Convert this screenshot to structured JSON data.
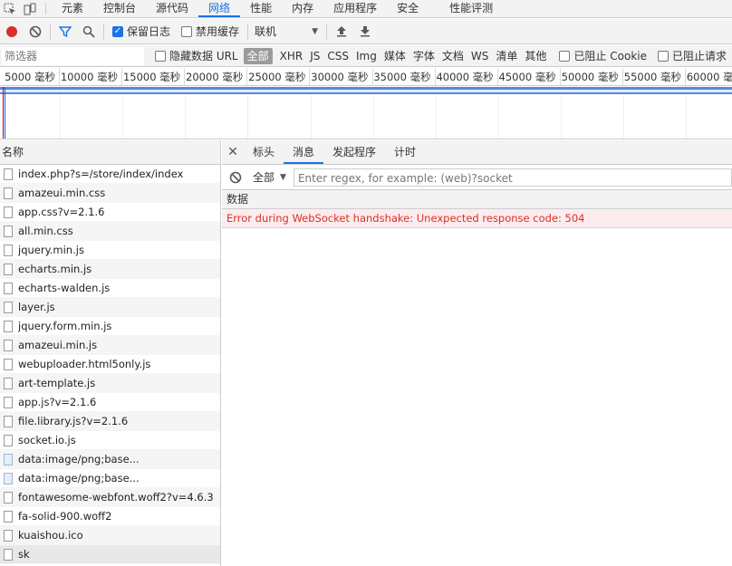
{
  "top_tabs": [
    "元素",
    "控制台",
    "源代码",
    "网络",
    "性能",
    "内存",
    "应用程序",
    "安全",
    "性能评测"
  ],
  "active_tab_index": 3,
  "toolbar": {
    "preserve_log_label": "保留日志",
    "preserve_log_checked": true,
    "disable_cache_label": "禁用缓存",
    "disable_cache_checked": false,
    "throttle_value": "联机"
  },
  "filter": {
    "placeholder": "筛选器",
    "hide_data_urls_label": "隐藏数据 URL",
    "types": [
      "全部",
      "XHR",
      "JS",
      "CSS",
      "Img",
      "媒体",
      "字体",
      "文档",
      "WS",
      "清单",
      "其他"
    ],
    "active_type_index": 0,
    "blocked_cookies_label": "已阻止 Cookie",
    "blocked_requests_label": "已阻止请求"
  },
  "ruler_ticks": [
    "5000 毫秒",
    "10000 毫秒",
    "15000 毫秒",
    "20000 毫秒",
    "25000 毫秒",
    "30000 毫秒",
    "35000 毫秒",
    "40000 毫秒",
    "45000 毫秒",
    "50000 毫秒",
    "55000 毫秒",
    "60000 毫秒"
  ],
  "requests": {
    "header": "名称",
    "items": [
      {
        "name": "index.php?s=/store/index/index",
        "kind": "doc"
      },
      {
        "name": "amazeui.min.css",
        "kind": "doc"
      },
      {
        "name": "app.css?v=2.1.6",
        "kind": "doc"
      },
      {
        "name": "all.min.css",
        "kind": "doc"
      },
      {
        "name": "jquery.min.js",
        "kind": "doc"
      },
      {
        "name": "echarts.min.js",
        "kind": "doc"
      },
      {
        "name": "echarts-walden.js",
        "kind": "doc"
      },
      {
        "name": "layer.js",
        "kind": "doc"
      },
      {
        "name": "jquery.form.min.js",
        "kind": "doc"
      },
      {
        "name": "amazeui.min.js",
        "kind": "doc"
      },
      {
        "name": "webuploader.html5only.js",
        "kind": "doc"
      },
      {
        "name": "art-template.js",
        "kind": "doc"
      },
      {
        "name": "app.js?v=2.1.6",
        "kind": "doc"
      },
      {
        "name": "file.library.js?v=2.1.6",
        "kind": "doc"
      },
      {
        "name": "socket.io.js",
        "kind": "doc"
      },
      {
        "name": "data:image/png;base...",
        "kind": "img"
      },
      {
        "name": "data:image/png;base...",
        "kind": "img"
      },
      {
        "name": "fontawesome-webfont.woff2?v=4.6.3",
        "kind": "doc"
      },
      {
        "name": "fa-solid-900.woff2",
        "kind": "doc"
      },
      {
        "name": "kuaishou.ico",
        "kind": "doc"
      },
      {
        "name": "sk",
        "kind": "doc",
        "selected": true
      }
    ]
  },
  "detail": {
    "tabs": [
      "标头",
      "消息",
      "发起程序",
      "计时"
    ],
    "active_tab_index": 1,
    "message_filter_label": "全部",
    "regex_placeholder": "Enter regex, for example: (web)?socket",
    "data_header": "数据",
    "error_message": "Error during WebSocket handshake: Unexpected response code: 504"
  },
  "colors": {
    "accent": "#1a73e8",
    "record": "#d93025",
    "error_text": "#d93025",
    "error_bg": "#fdecee"
  }
}
